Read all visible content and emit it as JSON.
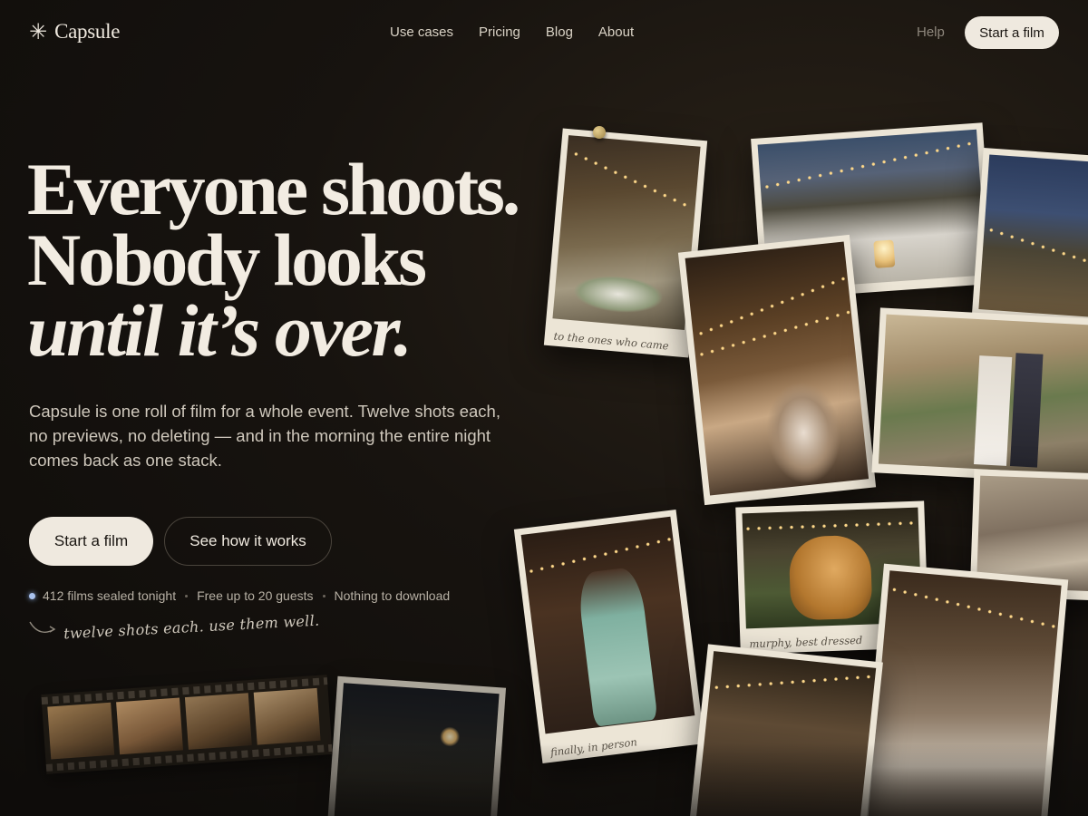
{
  "brand": {
    "name": "Capsule",
    "mark": "✳"
  },
  "nav": {
    "links": [
      "Use cases",
      "Pricing",
      "Blog",
      "About"
    ],
    "help": "Help",
    "cta": "Start a film"
  },
  "hero": {
    "headline_line1": "Everyone shoots.",
    "headline_line2": "Nobody looks",
    "headline_line3": "until it’s over.",
    "lede": "Capsule is one roll of film for a whole event. Twelve shots each, no previews, no deleting — and in the morning the entire night comes back as one stack.",
    "primary_cta": "Start a film",
    "secondary_cta": "See how it works",
    "stats": [
      "412 films sealed tonight",
      "Free up to 20 guests",
      "Nothing to download"
    ],
    "handwritten_note": "twelve shots each. use them well."
  },
  "photos": {
    "captions": {
      "dinner": "to the ones who came",
      "dog": "murphy, best dressed",
      "hug": "finally, in person"
    }
  },
  "colors": {
    "background": "#141110",
    "cream": "#efe9df",
    "live_dot": "#a9c2ee"
  }
}
